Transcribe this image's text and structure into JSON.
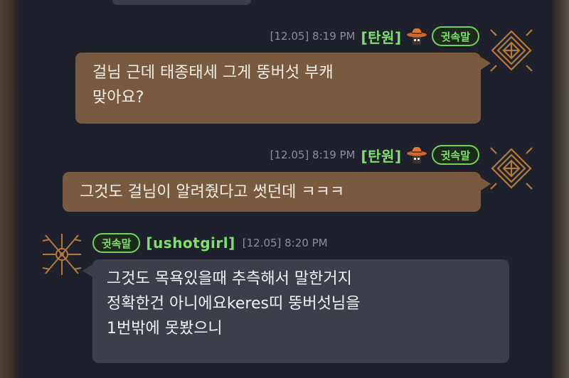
{
  "messages": [
    {
      "side": "right",
      "timestamp": "[12.05] 8:19 PM",
      "nickname": "[탄원]",
      "badge": "귓속말",
      "lines": [
        "걸님 근데 태종태세 그게 뚱버섯 부캐",
        "맞아요?"
      ],
      "avatar_icon": "diamond-emblem-icon",
      "hat_icon": "cowboy-hat-icon"
    },
    {
      "side": "right",
      "timestamp": "[12.05] 8:19 PM",
      "nickname": "[탄원]",
      "badge": "귓속말",
      "lines": [
        "그것도 걸님이 알려줬다고 썻던데 ㅋㅋㅋ"
      ],
      "avatar_icon": "diamond-emblem-icon",
      "hat_icon": "cowboy-hat-icon"
    },
    {
      "side": "left",
      "timestamp": "[12.05] 8:20 PM",
      "nickname": "[ushotgirl]",
      "badge": "귓속말",
      "lines": [
        "그것도 목욕있을때 추측해서 말한거지",
        "정확한건 아니에요keres띠  뚱버섯님을",
        "1번밖에 못봤으니"
      ],
      "avatar_icon": "crossed-swords-emblem-icon"
    }
  ],
  "colors": {
    "background": "#1e212b",
    "my_bubble": "#7a5a3e",
    "other_bubble": "#3c3f49",
    "nickname": "#7ee06e",
    "timestamp": "#8b8e97"
  }
}
